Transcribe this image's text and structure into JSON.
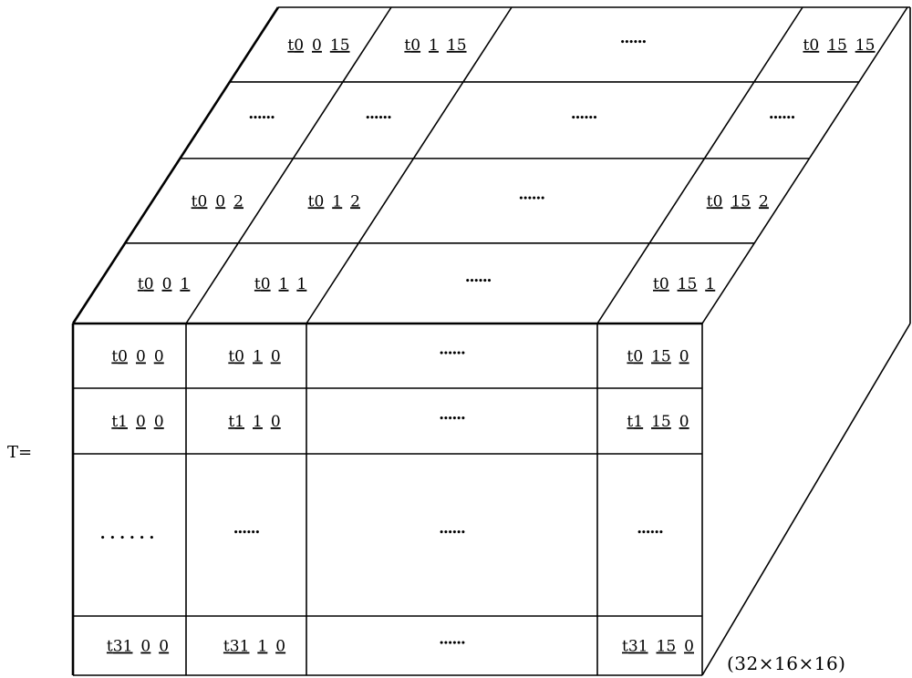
{
  "diagram": {
    "lhs_label": "T=",
    "dimension_label": "(32×16×16)",
    "ellipsis": "......",
    "front_face": {
      "description": "rows index i (0..31), columns index j (0..15), k = 0",
      "rows": [
        {
          "label": "row-t0",
          "cells": [
            {
              "prefix": "t",
              "parts": [
                "0",
                "0",
                "0"
              ]
            },
            {
              "prefix": "t",
              "parts": [
                "0",
                "1",
                "0"
              ]
            },
            {
              "ellipsis": true
            },
            {
              "prefix": "t",
              "parts": [
                "0",
                "15",
                "0"
              ]
            }
          ]
        },
        {
          "label": "row-t1",
          "cells": [
            {
              "prefix": "t",
              "parts": [
                "1",
                "0",
                "0"
              ]
            },
            {
              "prefix": "t",
              "parts": [
                "1",
                "1",
                "0"
              ]
            },
            {
              "ellipsis": true
            },
            {
              "prefix": "t",
              "parts": [
                "1",
                "15",
                "0"
              ]
            }
          ]
        },
        {
          "label": "row-ellipsis",
          "cells": [
            {
              "ellipsis": true,
              "sparse": true
            },
            {
              "ellipsis": true
            },
            {
              "ellipsis": true
            },
            {
              "ellipsis": true
            }
          ]
        },
        {
          "label": "row-t31",
          "cells": [
            {
              "prefix": "t",
              "parts": [
                "31",
                "0",
                "0"
              ]
            },
            {
              "prefix": "t",
              "parts": [
                "31",
                "1",
                "0"
              ]
            },
            {
              "ellipsis": true
            },
            {
              "prefix": "t",
              "parts": [
                "31",
                "15",
                "0"
              ]
            }
          ]
        }
      ]
    },
    "top_face": {
      "description": "depth layers k = 1, 2, ..., 15 for row i = 0",
      "layers": [
        {
          "label": "layer-k1",
          "cells": [
            {
              "prefix": "t",
              "parts": [
                "0",
                "0",
                "1"
              ]
            },
            {
              "prefix": "t",
              "parts": [
                "0",
                "1",
                "1"
              ]
            },
            {
              "ellipsis": true
            },
            {
              "prefix": "t",
              "parts": [
                "0",
                "15",
                "1"
              ]
            }
          ]
        },
        {
          "label": "layer-k2",
          "cells": [
            {
              "prefix": "t",
              "parts": [
                "0",
                "0",
                "2"
              ]
            },
            {
              "prefix": "t",
              "parts": [
                "0",
                "1",
                "2"
              ]
            },
            {
              "ellipsis": true
            },
            {
              "prefix": "t",
              "parts": [
                "0",
                "15",
                "2"
              ]
            }
          ]
        },
        {
          "label": "layer-ellipsis",
          "cells": [
            {
              "ellipsis": true
            },
            {
              "ellipsis": true
            },
            {
              "ellipsis": true
            },
            {
              "ellipsis": true
            }
          ]
        },
        {
          "label": "layer-k15",
          "cells": [
            {
              "prefix": "t",
              "parts": [
                "0",
                "0",
                "15"
              ]
            },
            {
              "prefix": "t",
              "parts": [
                "0",
                "1",
                "15"
              ]
            },
            {
              "ellipsis": true
            },
            {
              "prefix": "t",
              "parts": [
                "0",
                "15",
                "15"
              ]
            }
          ]
        }
      ]
    }
  }
}
